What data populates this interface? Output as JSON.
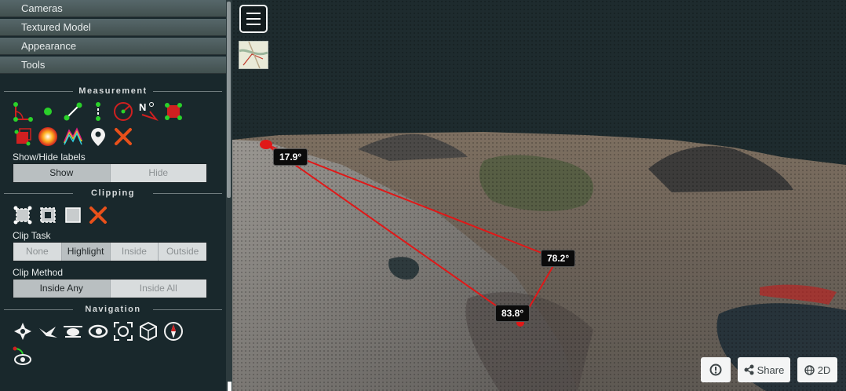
{
  "sidebar": {
    "menus": [
      {
        "label": "Cameras"
      },
      {
        "label": "Textured Model"
      },
      {
        "label": "Appearance"
      },
      {
        "label": "Tools"
      }
    ],
    "measurement": {
      "title": "Measurement",
      "labels_title": "Show/Hide labels",
      "labels_options": [
        "Show",
        "Hide"
      ],
      "labels_selected": "Show",
      "tools": [
        "angle-icon",
        "point-icon",
        "distance-icon",
        "height-icon",
        "circle-icon",
        "azimuth-icon",
        "area-icon",
        "volume-icon",
        "sphere-volume-icon",
        "profile-icon",
        "annotation-pin-icon",
        "clear-icon"
      ]
    },
    "clipping": {
      "title": "Clipping",
      "tools": [
        "clip-polygon-icon",
        "clip-box-icon",
        "clip-volume-icon",
        "clip-clear-icon"
      ],
      "task_title": "Clip Task",
      "task_options": [
        "None",
        "Highlight",
        "Inside",
        "Outside"
      ],
      "task_selected": "Highlight",
      "method_title": "Clip Method",
      "method_options": [
        "Inside Any",
        "Inside All"
      ],
      "method_selected": "Inside Any"
    },
    "navigation": {
      "title": "Navigation",
      "tools": [
        "earth-control-icon",
        "fly-control-icon",
        "helicopter-control-icon",
        "orbit-control-icon",
        "focus-icon",
        "cube-view-icon",
        "compass-icon",
        "camera-animation-icon"
      ]
    }
  },
  "viewport": {
    "angles": [
      {
        "value": "17.9°"
      },
      {
        "value": "78.2°"
      },
      {
        "value": "83.8°"
      }
    ],
    "buttons": {
      "info_icon": "info-icon",
      "share_label": "Share",
      "view2d_label": "2D"
    },
    "colors": {
      "measure_line": "#e01818",
      "sky": "#1e2b2e"
    }
  }
}
